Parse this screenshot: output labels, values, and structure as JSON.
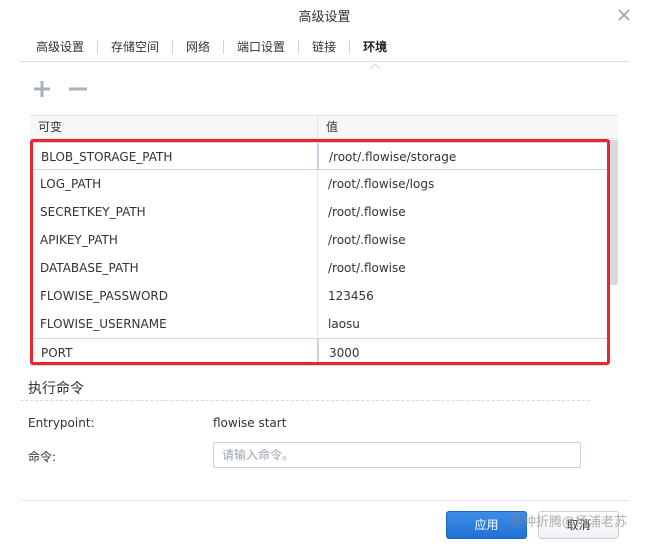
{
  "dialog": {
    "title": "高级设置",
    "close_icon": "close-icon"
  },
  "tabs": [
    {
      "label": "高级设置"
    },
    {
      "label": "存储空间"
    },
    {
      "label": "网络"
    },
    {
      "label": "端口设置"
    },
    {
      "label": "链接"
    },
    {
      "label": "环境",
      "active": true
    }
  ],
  "toolbar": {
    "add_icon": "plus-icon",
    "remove_icon": "minus-icon"
  },
  "env_table": {
    "headers": {
      "key": "可变",
      "value": "值"
    },
    "rows": [
      {
        "key": "BLOB_STORAGE_PATH",
        "value": "/root/.flowise/storage"
      },
      {
        "key": "LOG_PATH",
        "value": "/root/.flowise/logs"
      },
      {
        "key": "SECRETKEY_PATH",
        "value": "/root/.flowise"
      },
      {
        "key": "APIKEY_PATH",
        "value": "/root/.flowise"
      },
      {
        "key": "DATABASE_PATH",
        "value": "/root/.flowise"
      },
      {
        "key": "FLOWISE_PASSWORD",
        "value": "123456"
      },
      {
        "key": "FLOWISE_USERNAME",
        "value": "laosu"
      },
      {
        "key": "PORT",
        "value": "3000"
      }
    ]
  },
  "exec": {
    "section_title": "执行命令",
    "entrypoint_label": "Entrypoint:",
    "entrypoint_value": "flowise start",
    "command_label": "命令:",
    "command_placeholder": "请输入命令。"
  },
  "footer": {
    "apply_label": "应用",
    "cancel_label": "取消"
  },
  "watermark": "各种折腾@杨浦老苏",
  "colors": {
    "primary": "#1f72d6",
    "highlight": "#e8262b"
  }
}
